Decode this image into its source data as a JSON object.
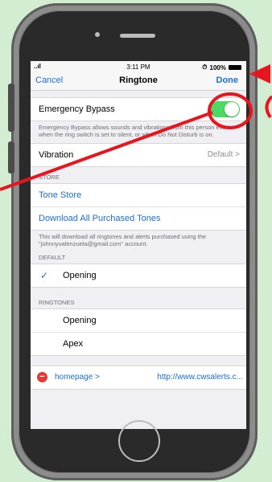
{
  "status_bar": {
    "signal": "..ıl",
    "time": "3:11 PM",
    "battery": "100%"
  },
  "navbar": {
    "cancel_label": "Cancel",
    "title": "Ringtone",
    "done_label": "Done"
  },
  "emergency_bypass": {
    "label": "Emergency Bypass",
    "enabled": true,
    "footnote": "Emergency Bypass allows sounds and vibrations from this person even when the ring switch is set to silent, or when Do Not Disturb is on."
  },
  "vibration": {
    "label": "Vibration",
    "value": "Default >"
  },
  "store": {
    "header": "STORE",
    "tone_store": "Tone Store",
    "download_all": "Download All Purchased Tones",
    "footnote": "This will download all ringtones and alerts purchased using the \"johnnyvalenzuela@gmail.com\" account."
  },
  "default_section": {
    "header": "DEFAULT",
    "items": [
      "Opening"
    ],
    "selected": "Opening"
  },
  "ringtones": {
    "header": "RINGTONES",
    "items": [
      "Opening",
      "Apex"
    ]
  },
  "url_row": {
    "label": "homepage >",
    "value": "http://www.cwsalerts.c..."
  },
  "colors": {
    "accent": "#1a6fe0",
    "toggle_on": "#4cd964",
    "annotation": "#e8141e",
    "background": "#d3edd3"
  },
  "icons": {
    "check": "checkmark-icon",
    "delete": "minus-circle-icon"
  }
}
